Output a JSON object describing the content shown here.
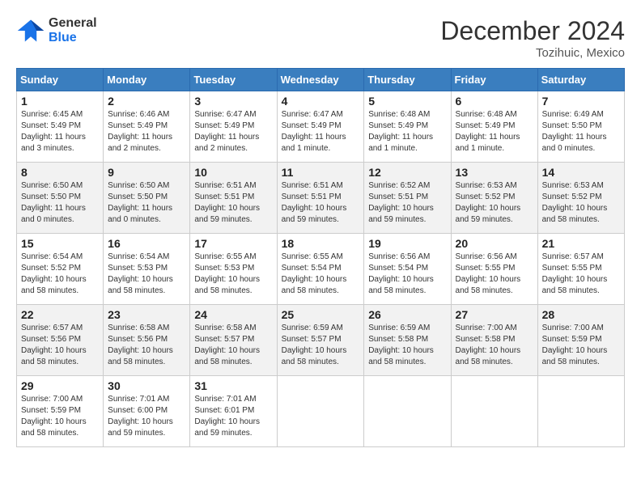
{
  "header": {
    "logo_line1": "General",
    "logo_line2": "Blue",
    "month": "December 2024",
    "location": "Tozihuic, Mexico"
  },
  "weekdays": [
    "Sunday",
    "Monday",
    "Tuesday",
    "Wednesday",
    "Thursday",
    "Friday",
    "Saturday"
  ],
  "weeks": [
    [
      {
        "day": "1",
        "info": "Sunrise: 6:45 AM\nSunset: 5:49 PM\nDaylight: 11 hours\nand 3 minutes."
      },
      {
        "day": "2",
        "info": "Sunrise: 6:46 AM\nSunset: 5:49 PM\nDaylight: 11 hours\nand 2 minutes."
      },
      {
        "day": "3",
        "info": "Sunrise: 6:47 AM\nSunset: 5:49 PM\nDaylight: 11 hours\nand 2 minutes."
      },
      {
        "day": "4",
        "info": "Sunrise: 6:47 AM\nSunset: 5:49 PM\nDaylight: 11 hours\nand 1 minute."
      },
      {
        "day": "5",
        "info": "Sunrise: 6:48 AM\nSunset: 5:49 PM\nDaylight: 11 hours\nand 1 minute."
      },
      {
        "day": "6",
        "info": "Sunrise: 6:48 AM\nSunset: 5:49 PM\nDaylight: 11 hours\nand 1 minute."
      },
      {
        "day": "7",
        "info": "Sunrise: 6:49 AM\nSunset: 5:50 PM\nDaylight: 11 hours\nand 0 minutes."
      }
    ],
    [
      {
        "day": "8",
        "info": "Sunrise: 6:50 AM\nSunset: 5:50 PM\nDaylight: 11 hours\nand 0 minutes."
      },
      {
        "day": "9",
        "info": "Sunrise: 6:50 AM\nSunset: 5:50 PM\nDaylight: 11 hours\nand 0 minutes."
      },
      {
        "day": "10",
        "info": "Sunrise: 6:51 AM\nSunset: 5:51 PM\nDaylight: 10 hours\nand 59 minutes."
      },
      {
        "day": "11",
        "info": "Sunrise: 6:51 AM\nSunset: 5:51 PM\nDaylight: 10 hours\nand 59 minutes."
      },
      {
        "day": "12",
        "info": "Sunrise: 6:52 AM\nSunset: 5:51 PM\nDaylight: 10 hours\nand 59 minutes."
      },
      {
        "day": "13",
        "info": "Sunrise: 6:53 AM\nSunset: 5:52 PM\nDaylight: 10 hours\nand 59 minutes."
      },
      {
        "day": "14",
        "info": "Sunrise: 6:53 AM\nSunset: 5:52 PM\nDaylight: 10 hours\nand 58 minutes."
      }
    ],
    [
      {
        "day": "15",
        "info": "Sunrise: 6:54 AM\nSunset: 5:52 PM\nDaylight: 10 hours\nand 58 minutes."
      },
      {
        "day": "16",
        "info": "Sunrise: 6:54 AM\nSunset: 5:53 PM\nDaylight: 10 hours\nand 58 minutes."
      },
      {
        "day": "17",
        "info": "Sunrise: 6:55 AM\nSunset: 5:53 PM\nDaylight: 10 hours\nand 58 minutes."
      },
      {
        "day": "18",
        "info": "Sunrise: 6:55 AM\nSunset: 5:54 PM\nDaylight: 10 hours\nand 58 minutes."
      },
      {
        "day": "19",
        "info": "Sunrise: 6:56 AM\nSunset: 5:54 PM\nDaylight: 10 hours\nand 58 minutes."
      },
      {
        "day": "20",
        "info": "Sunrise: 6:56 AM\nSunset: 5:55 PM\nDaylight: 10 hours\nand 58 minutes."
      },
      {
        "day": "21",
        "info": "Sunrise: 6:57 AM\nSunset: 5:55 PM\nDaylight: 10 hours\nand 58 minutes."
      }
    ],
    [
      {
        "day": "22",
        "info": "Sunrise: 6:57 AM\nSunset: 5:56 PM\nDaylight: 10 hours\nand 58 minutes."
      },
      {
        "day": "23",
        "info": "Sunrise: 6:58 AM\nSunset: 5:56 PM\nDaylight: 10 hours\nand 58 minutes."
      },
      {
        "day": "24",
        "info": "Sunrise: 6:58 AM\nSunset: 5:57 PM\nDaylight: 10 hours\nand 58 minutes."
      },
      {
        "day": "25",
        "info": "Sunrise: 6:59 AM\nSunset: 5:57 PM\nDaylight: 10 hours\nand 58 minutes."
      },
      {
        "day": "26",
        "info": "Sunrise: 6:59 AM\nSunset: 5:58 PM\nDaylight: 10 hours\nand 58 minutes."
      },
      {
        "day": "27",
        "info": "Sunrise: 7:00 AM\nSunset: 5:58 PM\nDaylight: 10 hours\nand 58 minutes."
      },
      {
        "day": "28",
        "info": "Sunrise: 7:00 AM\nSunset: 5:59 PM\nDaylight: 10 hours\nand 58 minutes."
      }
    ],
    [
      {
        "day": "29",
        "info": "Sunrise: 7:00 AM\nSunset: 5:59 PM\nDaylight: 10 hours\nand 58 minutes."
      },
      {
        "day": "30",
        "info": "Sunrise: 7:01 AM\nSunset: 6:00 PM\nDaylight: 10 hours\nand 59 minutes."
      },
      {
        "day": "31",
        "info": "Sunrise: 7:01 AM\nSunset: 6:01 PM\nDaylight: 10 hours\nand 59 minutes."
      },
      null,
      null,
      null,
      null
    ]
  ]
}
